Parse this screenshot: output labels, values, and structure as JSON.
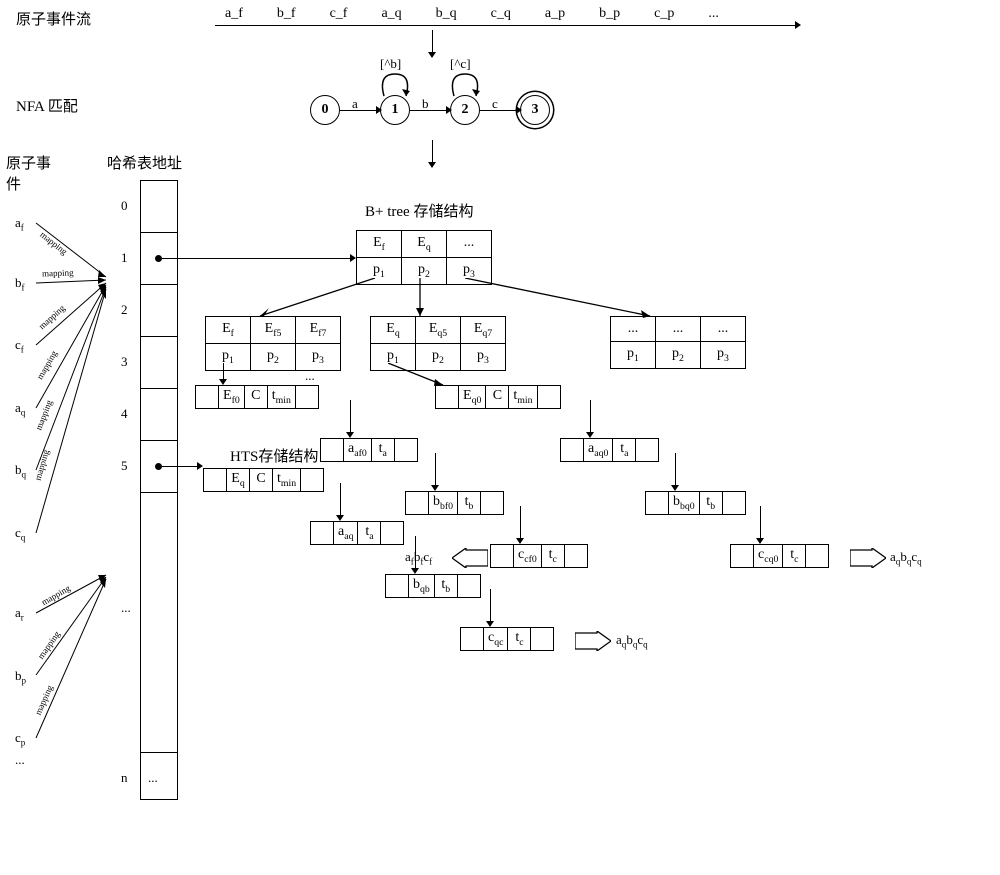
{
  "labels": {
    "stream": "原子事件流",
    "nfa": "NFA 匹配",
    "atomEvent": "原子事\n件",
    "hashAddr": "哈希表地址",
    "bptree": "B+ tree 存储结构",
    "hts": "HTS存储结构"
  },
  "stream": [
    "a_f",
    "b_f",
    "c_f",
    "a_q",
    "b_q",
    "c_q",
    "a_p",
    "b_p",
    "c_p",
    "..."
  ],
  "nfa": {
    "nodes": [
      "0",
      "1",
      "2",
      "3"
    ],
    "edges": [
      "a",
      "b",
      "c"
    ],
    "loops": [
      "[^b]",
      "[^c]"
    ]
  },
  "atoms": [
    "a_f",
    "b_f",
    "c_f",
    "a_q",
    "b_q",
    "c_q",
    "a_r",
    "b_p",
    "c_p",
    "..."
  ],
  "hashIdx": [
    "0",
    "1",
    "2",
    "3",
    "4",
    "5",
    "...",
    "n"
  ],
  "mapping": "mapping",
  "bptree": {
    "root": {
      "keys": [
        "E_f",
        "E_q",
        "..."
      ],
      "ptrs": [
        "p_1",
        "p_2",
        "p_3"
      ]
    },
    "l2": [
      {
        "keys": [
          "E_f",
          "E_f5",
          "E_f7"
        ],
        "ptrs": [
          "p_1",
          "p_2",
          "p_3"
        ]
      },
      {
        "keys": [
          "E_q",
          "E_q5",
          "E_q7"
        ],
        "ptrs": [
          "p_1",
          "p_2",
          "p_3"
        ]
      },
      {
        "keys": [
          "...",
          "...",
          "..."
        ],
        "ptrs": [
          "p_1",
          "p_2",
          "p_3"
        ]
      }
    ],
    "leafF": [
      "E_f0",
      "C",
      "t_min"
    ],
    "leafQ": [
      "E_q0",
      "C",
      "t_min"
    ],
    "dots": "...",
    "chainF": [
      [
        "a_af0",
        "t_a"
      ],
      [
        "b_bf0",
        "t_b"
      ],
      [
        "c_cf0",
        "t_c"
      ]
    ],
    "chainQ": [
      [
        "a_aq0",
        "t_a"
      ],
      [
        "b_bq0",
        "t_b"
      ],
      [
        "c_cq0",
        "t_c"
      ]
    ],
    "outF": "a_fb_fc_f",
    "outQ": "a_qb_qc_q"
  },
  "hts": {
    "head": [
      "E_q",
      "C",
      "t_min"
    ],
    "chain": [
      [
        "a_aq",
        "t_a"
      ],
      [
        "b_qb",
        "t_b"
      ],
      [
        "c_qc",
        "t_c"
      ]
    ],
    "out": "a_qb_qc_q"
  }
}
